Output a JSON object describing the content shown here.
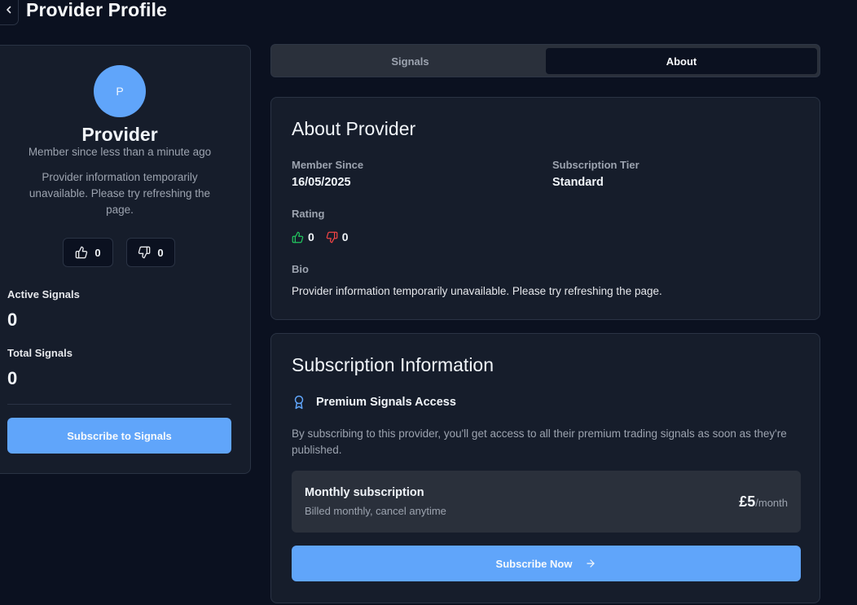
{
  "header": {
    "title": "Provider Profile"
  },
  "profile": {
    "avatar_initial": "P",
    "name": "Provider",
    "member_since": "Member since less than a minute ago",
    "bio": "Provider information temporarily unavailable. Please try refreshing the page.",
    "likes": "0",
    "dislikes": "0",
    "active_signals_label": "Active Signals",
    "active_signals_value": "0",
    "total_signals_label": "Total Signals",
    "total_signals_value": "0",
    "subscribe_label": "Subscribe to Signals"
  },
  "tabs": [
    {
      "label": "Signals",
      "active": false
    },
    {
      "label": "About",
      "active": true
    }
  ],
  "about": {
    "heading": "About Provider",
    "member_since_label": "Member Since",
    "member_since_value": "16/05/2025",
    "tier_label": "Subscription Tier",
    "tier_value": "Standard",
    "rating_label": "Rating",
    "rating_up": "0",
    "rating_down": "0",
    "bio_label": "Bio",
    "bio_value": "Provider information temporarily unavailable. Please try refreshing the page."
  },
  "subscription": {
    "heading": "Subscription Information",
    "access_title": "Premium Signals Access",
    "description": "By subscribing to this provider, you'll get access to all their premium trading signals as soon as they're published.",
    "plan_title": "Monthly subscription",
    "plan_subtitle": "Billed monthly, cancel anytime",
    "price": "£5",
    "price_period": "/month",
    "subscribe_now_label": "Subscribe Now"
  },
  "colors": {
    "background": "#0b1120",
    "card": "#161d2b",
    "accent": "#60a5fa",
    "thumbs_up": "#22c55e",
    "thumbs_down": "#ef4444"
  },
  "icons": [
    "chevron-left-icon",
    "thumbs-up-icon",
    "thumbs-down-icon",
    "award-icon",
    "arrow-right-icon"
  ]
}
